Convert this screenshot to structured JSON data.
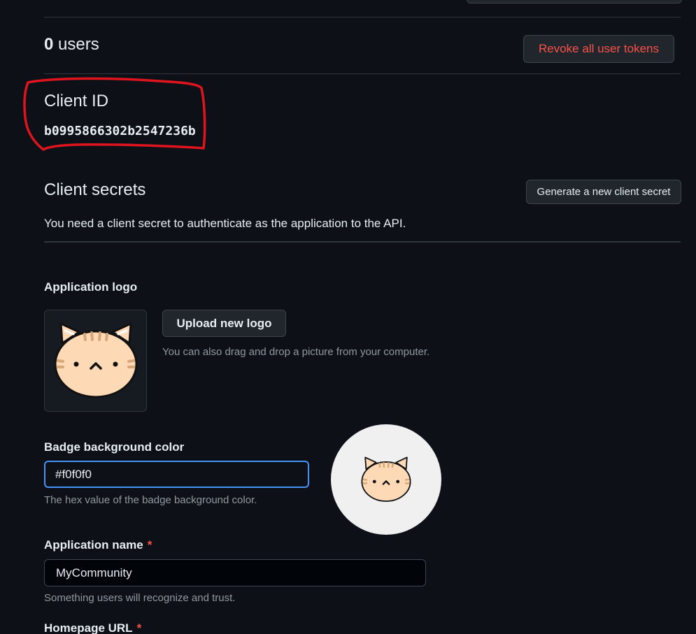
{
  "users": {
    "count": "0",
    "label": " users",
    "revoke_button": "Revoke all user tokens"
  },
  "client_id": {
    "title": "Client ID",
    "value": "b0995866302b2547236b"
  },
  "client_secrets": {
    "title": "Client secrets",
    "generate_button": "Generate a new client secret",
    "description": "You need a client secret to authenticate as the application to the API."
  },
  "application_logo": {
    "label": "Application logo",
    "upload_button": "Upload new logo",
    "hint": "You can also drag and drop a picture from your computer.",
    "icon": "cat-face-icon"
  },
  "badge_color": {
    "label": "Badge background color",
    "value": "#f0f0f0",
    "hint": "The hex value of the badge background color."
  },
  "application_name": {
    "label": "Application name",
    "required_mark": "*",
    "value": "MyCommunity",
    "hint": "Something users will recognize and trust."
  },
  "homepage_url": {
    "label": "Homepage URL",
    "required_mark": "*"
  },
  "colors": {
    "background": "#0d1117",
    "danger": "#f85149",
    "focus": "#4493f8",
    "annotation": "#e0141e",
    "badge_bg": "#f0f0f0"
  }
}
